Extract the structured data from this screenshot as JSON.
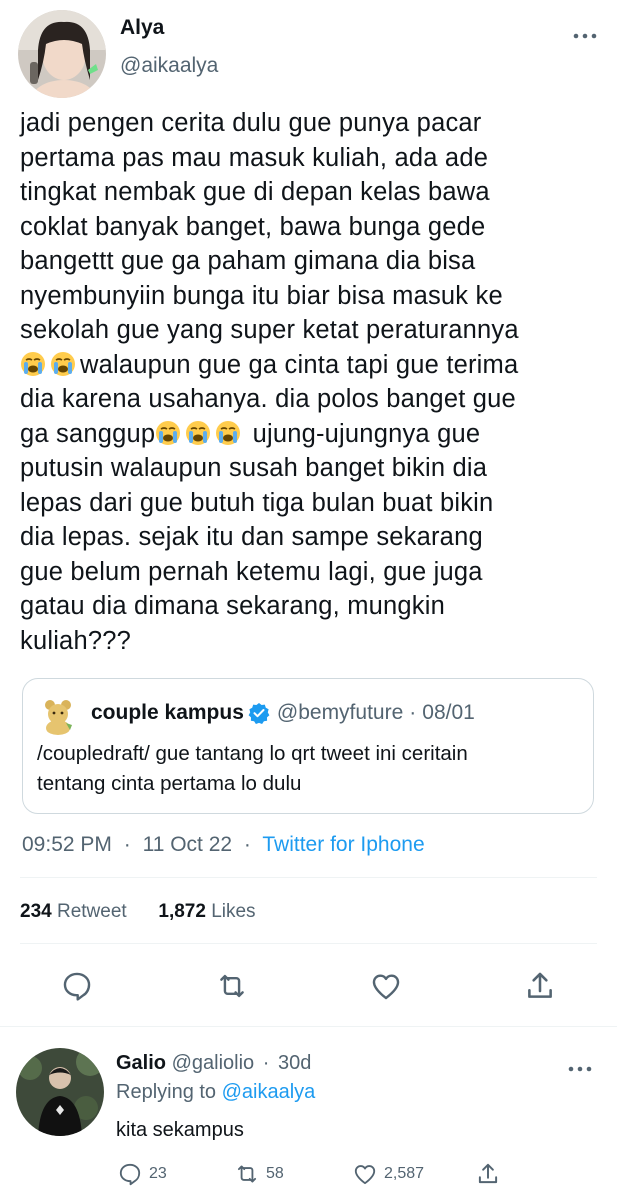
{
  "tweet": {
    "author_name": "Alya",
    "author_handle": "@aikaalya",
    "text_lines": [
      "jadi pengen cerita dulu gue punya pacar",
      "pertama pas mau masuk kuliah, ada ade",
      "tingkat nembak gue di depan kelas bawa",
      "coklat banyak banget, bawa bunga gede",
      "bangettt gue ga paham gimana dia bisa",
      "nyembunyiin bunga itu biar bisa masuk ke",
      "sekolah gue yang super ketat peraturannya",
      "walaupun gue ga cinta tapi gue terima",
      "dia karena usahanya. dia polos banget gue",
      "ga sanggup",
      "ujung-ujungnya gue",
      "putusin walaupun susah banget bikin dia",
      "lepas dari gue butuh tiga bulan buat bikin",
      "dia lepas. sejak itu dan sampe sekarang",
      "gue belum pernah ketemu lagi, gue juga",
      "gatau dia dimana sekarang, mungkin",
      "kuliah???"
    ],
    "emoji": "loudly-crying-face",
    "quoted": {
      "name": "couple kampus",
      "handle": "@bemyfuture",
      "date": "08/01",
      "text_lines": [
        "/coupledraft/ gue tantang lo qrt tweet ini ceritain",
        "tentang cinta pertama lo dulu"
      ]
    },
    "time": "09:52 PM",
    "date": "11 Oct 22",
    "source": "Twitter for Iphone",
    "retweets_count": "234",
    "retweets_label": "Retweet",
    "likes_count": "1,872",
    "likes_label": "Likes"
  },
  "reply": {
    "name": "Galio",
    "handle": "@galiolio",
    "time": "30d",
    "replying_to_label": "Replying to",
    "replying_to_handle": "@aikaalya",
    "text": "kita sekampus",
    "reply_count": "23",
    "retweet_count": "58",
    "like_count": "2,587"
  },
  "colors": {
    "text": "#0f1419",
    "secondary": "#536471",
    "link": "#1d9bf0",
    "border": "#cfd9de"
  }
}
